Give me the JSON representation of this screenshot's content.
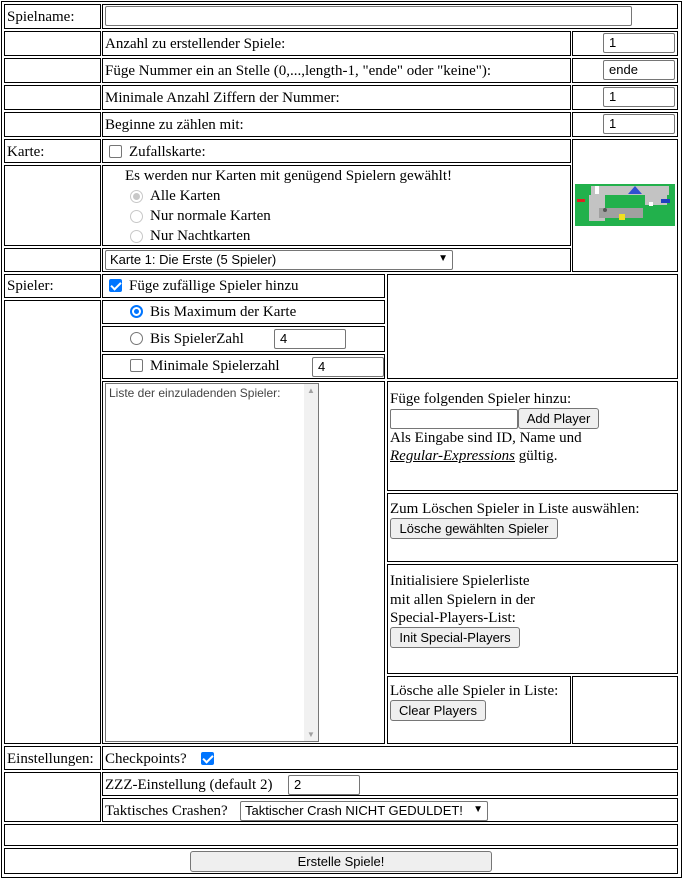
{
  "form": {
    "spielname_label": "Spielname:",
    "spielname_value": "",
    "anzahl_label": "Anzahl zu erstellender Spiele:",
    "anzahl_value": "1",
    "nummer_label": "Füge Nummer ein an Stelle (0,...,length-1, \"ende\" oder \"keine\"):",
    "nummer_value": "ende",
    "ziffern_label": "Minimale Anzahl Ziffern der Nummer:",
    "ziffern_value": "1",
    "beginne_label": "Beginne zu zählen mit:",
    "beginne_value": "1"
  },
  "karte": {
    "label": "Karte:",
    "zufall_label": "Zufallskarte:",
    "zufall_checked": false,
    "info": "Es werden nur Karten mit genügend Spielern gewählt!",
    "options": [
      "Alle Karten",
      "Nur normale Karten",
      "Nur Nachtkarten"
    ],
    "selected": "Karte 1: Die Erste (5 Spieler)"
  },
  "spieler": {
    "label": "Spieler:",
    "random_label": "Füge zufällige Spieler hinzu",
    "random_checked": true,
    "bis_max_label": "Bis Maximum der Karte",
    "bis_zahl_label": "Bis SpielerZahl",
    "bis_zahl_value": "4",
    "min_label": "Minimale Spielerzahl",
    "min_value": "4",
    "list_placeholder": "Liste der einzuladenden Spieler:",
    "add_title": "Füge folgenden Spieler hinzu:",
    "add_value": "",
    "add_button": "Add Player",
    "add_hint_1": "Als Eingabe sind ID, Name und",
    "add_hint_link": "Regular-Expressions",
    "add_hint_2": " gültig.",
    "delete_title": "Zum Löschen Spieler in Liste auswählen:",
    "delete_button": "Lösche gewählten Spieler",
    "init_line1": "Initialisiere Spielerliste",
    "init_line2": "mit allen Spielern in der",
    "init_line3": "Special-Players-List:",
    "init_button": "Init Special-Players",
    "clear_title": "Lösche alle Spieler in Liste:",
    "clear_button": "Clear Players"
  },
  "einstellungen": {
    "label": "Einstellungen:",
    "checkpoints_label": "Checkpoints?",
    "checkpoints_checked": true,
    "zzz_label": "ZZZ-Einstellung (default 2)",
    "zzz_value": "2",
    "crash_label": "Taktisches Crashen?",
    "crash_selected": "Taktischer Crash NICHT GEDULDET!"
  },
  "submit_button": "Erstelle Spiele!",
  "colors": {
    "checkbox_accent": "#0075ff",
    "map_green": "#22b14c"
  }
}
